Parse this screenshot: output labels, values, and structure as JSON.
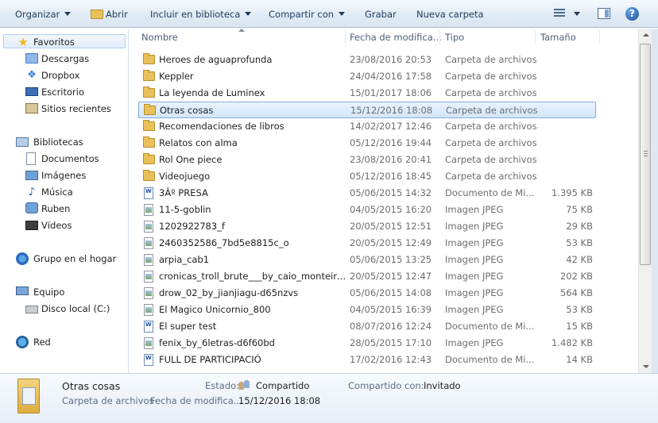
{
  "toolbar": {
    "organize": "Organizar",
    "open": "Abrir",
    "include_library": "Incluir en biblioteca",
    "share_with": "Compartir con",
    "burn": "Grabar",
    "new_folder": "Nueva carpeta",
    "help": "?"
  },
  "nav": {
    "favorites_header": "Favoritos",
    "favorites": [
      "Descargas",
      "Dropbox",
      "Escritorio",
      "Sitios recientes"
    ],
    "libraries_header": "Bibliotecas",
    "libraries": [
      "Documentos",
      "Imágenes",
      "Música",
      "Ruben",
      "Vídeos"
    ],
    "homegroup": "Grupo en el hogar",
    "computer_header": "Equipo",
    "computer": [
      "Disco local (C:)"
    ],
    "network": "Red"
  },
  "columns": {
    "name": "Nombre",
    "date": "Fecha de modifica...",
    "type": "Tipo",
    "size": "Tamaño"
  },
  "files": [
    {
      "name": "Heroes de aguaprofunda",
      "date": "23/08/2016 20:53",
      "type": "Carpeta de archivos",
      "size": "",
      "icon": "folder"
    },
    {
      "name": "Keppler",
      "date": "24/04/2016 17:58",
      "type": "Carpeta de archivos",
      "size": "",
      "icon": "folder"
    },
    {
      "name": "La leyenda de Luminex",
      "date": "15/01/2017 18:06",
      "type": "Carpeta de archivos",
      "size": "",
      "icon": "folder"
    },
    {
      "name": "Otras cosas",
      "date": "15/12/2016 18:08",
      "type": "Carpeta de archivos",
      "size": "",
      "icon": "folder",
      "selected": true
    },
    {
      "name": "Recomendaciones de libros",
      "date": "14/02/2017 12:46",
      "type": "Carpeta de archivos",
      "size": "",
      "icon": "folder"
    },
    {
      "name": "Relatos con alma",
      "date": "05/12/2016 19:44",
      "type": "Carpeta de archivos",
      "size": "",
      "icon": "folder"
    },
    {
      "name": "Rol One piece",
      "date": "23/08/2016 20:41",
      "type": "Carpeta de archivos",
      "size": "",
      "icon": "folder"
    },
    {
      "name": "Videojuego",
      "date": "05/12/2016 18:45",
      "type": "Carpeta de archivos",
      "size": "",
      "icon": "folder"
    },
    {
      "name": "3Âº PRESA",
      "date": "05/06/2015 14:32",
      "type": "Documento de Mi...",
      "size": "1.395 KB",
      "icon": "doc"
    },
    {
      "name": "11-5-goblin",
      "date": "04/05/2015 16:20",
      "type": "Imagen JPEG",
      "size": "75 KB",
      "icon": "jpg"
    },
    {
      "name": "1202922783_f",
      "date": "20/05/2015 12:51",
      "type": "Imagen JPEG",
      "size": "29 KB",
      "icon": "jpg"
    },
    {
      "name": "2460352586_7bd5e8815c_o",
      "date": "20/05/2015 12:49",
      "type": "Imagen JPEG",
      "size": "53 KB",
      "icon": "jpg"
    },
    {
      "name": "arpia_cab1",
      "date": "05/06/2015 13:25",
      "type": "Imagen JPEG",
      "size": "42 KB",
      "icon": "jpg"
    },
    {
      "name": "cronicas_troll_brute___by_caio_monteiro_...",
      "date": "20/05/2015 12:47",
      "type": "Imagen JPEG",
      "size": "202 KB",
      "icon": "jpg"
    },
    {
      "name": "drow_02_by_jianjiagu-d65nzvs",
      "date": "05/06/2015 14:08",
      "type": "Imagen JPEG",
      "size": "564 KB",
      "icon": "jpg"
    },
    {
      "name": "El Magico Unicornio_800",
      "date": "04/05/2015 16:39",
      "type": "Imagen JPEG",
      "size": "53 KB",
      "icon": "jpg"
    },
    {
      "name": "El super test",
      "date": "08/07/2016 12:24",
      "type": "Documento de Mi...",
      "size": "15 KB",
      "icon": "doc"
    },
    {
      "name": "fenix_by_6letras-d6f60bd",
      "date": "28/05/2015 17:10",
      "type": "Imagen JPEG",
      "size": "1.482 KB",
      "icon": "jpg"
    },
    {
      "name": "FULL DE PARTICIPACIÓ",
      "date": "17/02/2016 12:43",
      "type": "Documento de Mi...",
      "size": "14 KB",
      "icon": "doc"
    }
  ],
  "details": {
    "name": "Otras cosas",
    "type": "Carpeta de archivos",
    "state_label": "Estado:",
    "state_value": "Compartido",
    "date_label": "Fecha de modifica...",
    "date_value": "15/12/2016 18:08",
    "shared_with_label": "Compartido con:",
    "shared_with_value": "Invitado"
  }
}
